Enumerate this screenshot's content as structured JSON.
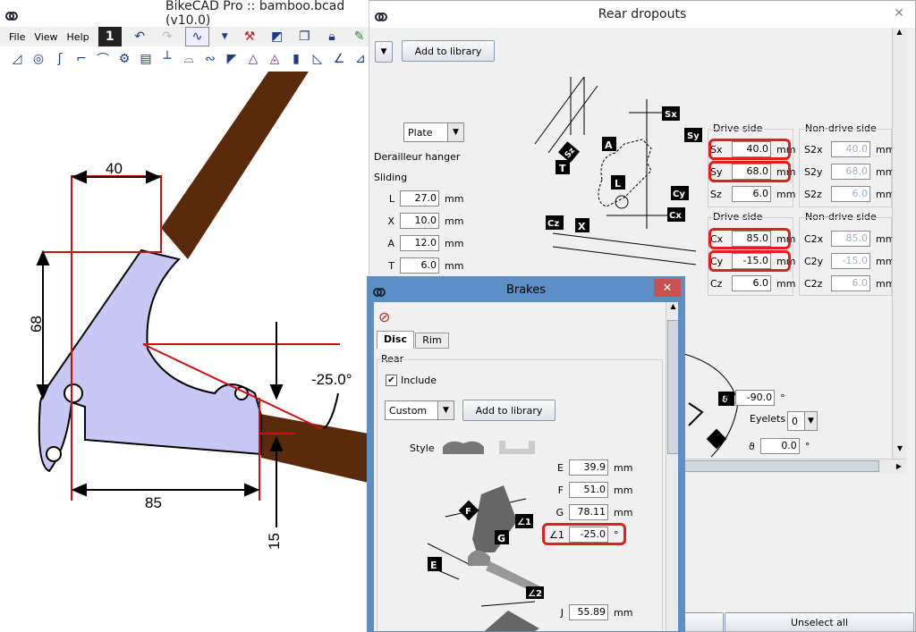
{
  "main_window": {
    "title": "BikeCAD Pro :: bamboo.bcad (v10.0)",
    "menu": [
      "File",
      "View",
      "Help"
    ]
  },
  "drawing": {
    "dim_top": "40",
    "dim_left": "68",
    "dim_bottom": "85",
    "dim_vertical_right": "15",
    "angle": "-25.0°"
  },
  "rear_dropouts": {
    "title": "Rear dropouts",
    "add_to_library": "Add to library",
    "style_select": "Plate",
    "derailleur_hanger": "Derailleur hanger",
    "sliding": "Sliding",
    "params": [
      {
        "label": "L",
        "value": "27.0",
        "unit": "mm"
      },
      {
        "label": "X",
        "value": "10.0",
        "unit": "mm"
      },
      {
        "label": "A",
        "value": "12.0",
        "unit": "mm"
      },
      {
        "label": "T",
        "value": "6.0",
        "unit": "mm"
      }
    ],
    "drive_side_label": "Drive side",
    "non_drive_side_label": "Non-drive side",
    "drive_s": [
      {
        "label": "Sx",
        "value": "40.0",
        "unit": "mm"
      },
      {
        "label": "Sy",
        "value": "68.0",
        "unit": "mm"
      },
      {
        "label": "Sz",
        "value": "6.0",
        "unit": "mm"
      }
    ],
    "non_drive_s": [
      {
        "label": "S2x",
        "value": "40.0",
        "unit": "mm"
      },
      {
        "label": "S2y",
        "value": "68.0",
        "unit": "mm"
      },
      {
        "label": "S2z",
        "value": "6.0",
        "unit": "mm"
      }
    ],
    "drive_c": [
      {
        "label": "Cx",
        "value": "85.0",
        "unit": "mm"
      },
      {
        "label": "Cy",
        "value": "-15.0",
        "unit": "mm"
      },
      {
        "label": "Cz",
        "value": "6.0",
        "unit": "mm"
      }
    ],
    "non_drive_c": [
      {
        "label": "C2x",
        "value": "85.0",
        "unit": "mm"
      },
      {
        "label": "C2y",
        "value": "-15.0",
        "unit": "mm"
      },
      {
        "label": "C2z",
        "value": "6.0",
        "unit": "mm"
      }
    ],
    "theta": {
      "label": "ξ",
      "value": "-90.0",
      "unit": "°"
    },
    "eyelets": {
      "label": "Eyelets",
      "value": "0"
    },
    "phi": {
      "label": "ϑ",
      "value": "0.0",
      "unit": "°"
    },
    "unselect_all": "Unselect all",
    "diagram_tags": [
      "Sx",
      "Sy",
      "Sz",
      "T",
      "A",
      "L",
      "Cy",
      "Cx",
      "Cz",
      "X"
    ]
  },
  "brakes": {
    "title": "Brakes",
    "tabs": [
      "Disc",
      "Rim"
    ],
    "group_rear": "Rear",
    "include_label": "Include",
    "preset": "Custom",
    "add_to_library": "Add to library",
    "style_label": "Style",
    "params": [
      {
        "label": "E",
        "value": "39.9",
        "unit": "mm"
      },
      {
        "label": "F",
        "value": "51.0",
        "unit": "mm"
      },
      {
        "label": "G",
        "value": "78.11",
        "unit": "mm"
      },
      {
        "label": "∠1",
        "value": "-25.0",
        "unit": "°"
      }
    ],
    "j": {
      "label": "J",
      "value": "55.89",
      "unit": "mm"
    },
    "diagram_tags": [
      "F",
      "∠1",
      "G",
      "E",
      "∠2"
    ]
  },
  "colors": {
    "tube": "#5a2a0a",
    "plate": "#c8c8f4",
    "dim_line": "#cc1010",
    "highlight": "#e02020",
    "brakes_title": "#5b8fc5"
  }
}
